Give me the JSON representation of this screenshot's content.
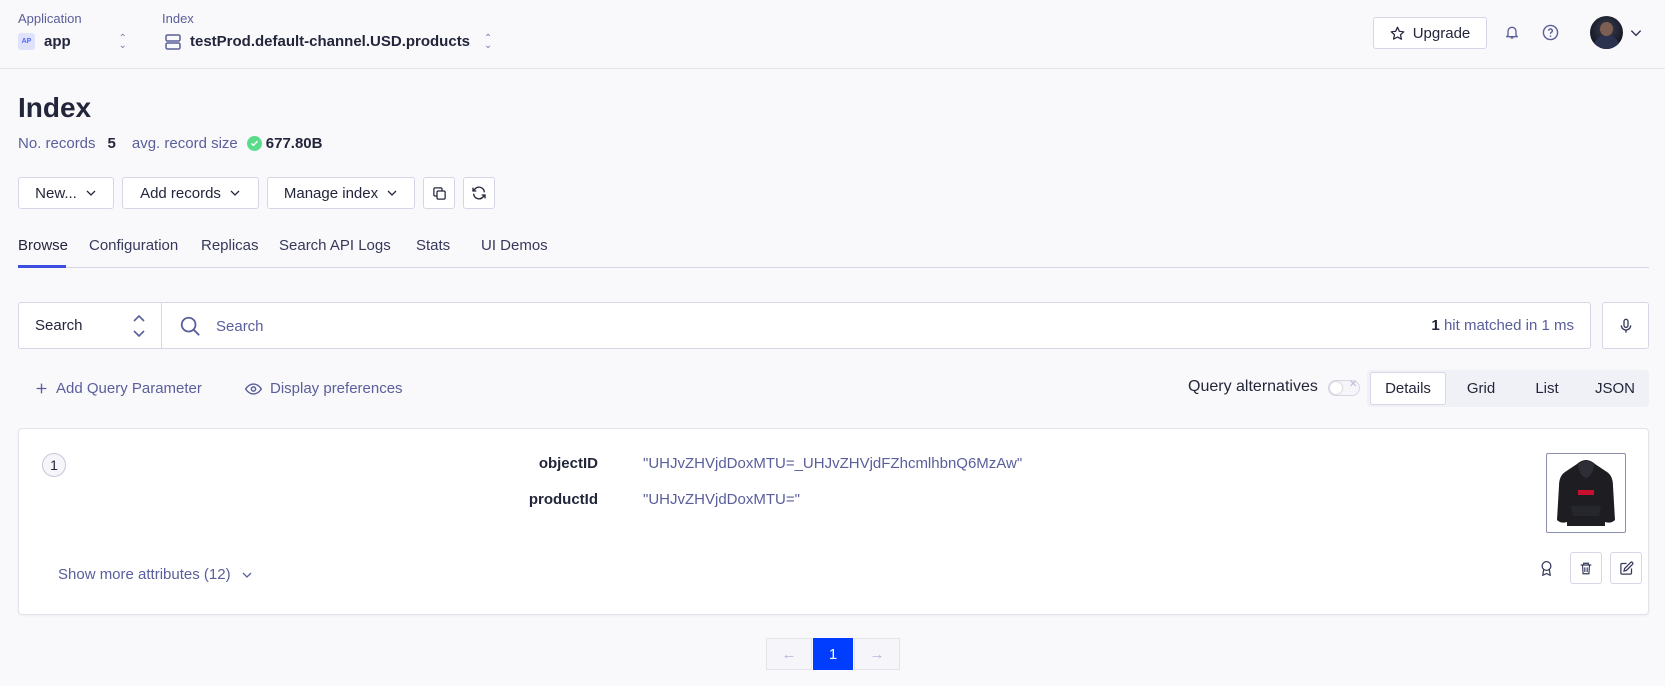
{
  "header": {
    "application": {
      "label": "Application",
      "badge": "AP",
      "value": "app"
    },
    "index": {
      "label": "Index",
      "value": "testProd.default-channel.USD.products"
    },
    "upgrade_label": "Upgrade"
  },
  "page": {
    "title": "Index",
    "records_label": "No. records",
    "records_value": "5",
    "size_label": "avg. record size",
    "size_value": "677.80B"
  },
  "toolbar": {
    "new_label": "New...",
    "add_records_label": "Add records",
    "manage_index_label": "Manage index"
  },
  "tabs": [
    {
      "label": "Browse",
      "active": true
    },
    {
      "label": "Configuration"
    },
    {
      "label": "Replicas"
    },
    {
      "label": "Search API Logs"
    },
    {
      "label": "Stats"
    },
    {
      "label": "UI Demos"
    }
  ],
  "search": {
    "type_label": "Search",
    "placeholder": "Search",
    "hits_count": "1",
    "hits_text": "hit matched in 1 ms"
  },
  "options": {
    "add_query_param": "Add Query Parameter",
    "display_prefs": "Display preferences",
    "query_alternatives": "Query alternatives",
    "views": [
      "Details",
      "Grid",
      "List",
      "JSON"
    ],
    "active_view": "Details"
  },
  "record": {
    "number": "1",
    "attributes": [
      {
        "name": "objectID",
        "value": "\"UHJvZHVjdDoxMTU=_UHJvZHVjdFZhcmlhbnQ6MzAw\""
      },
      {
        "name": "productId",
        "value": "\"UHJvZHVjdDoxMTU=\""
      }
    ],
    "show_more": "Show more attributes (12)"
  },
  "pagination": {
    "prev": "←",
    "current": "1",
    "next": "→"
  },
  "colors": {
    "accent": "#003dff",
    "tab_underline": "#3c4fe0",
    "success": "#5adc8a"
  }
}
